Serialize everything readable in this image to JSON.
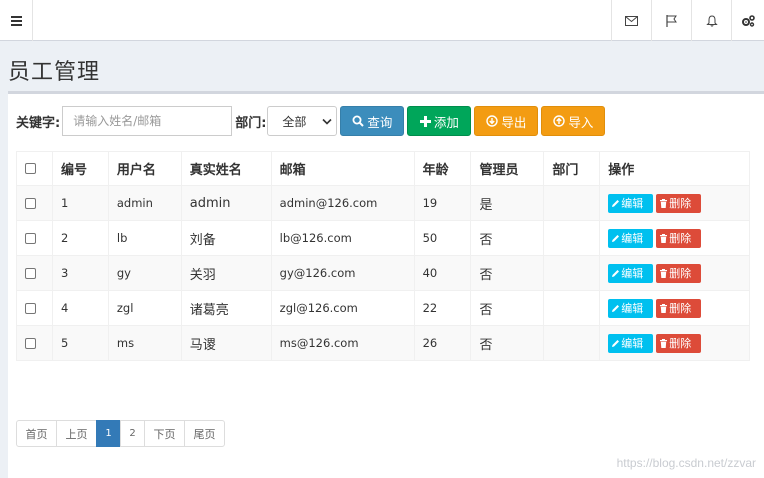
{
  "navbar": {
    "toggle_icon": "menu-icon",
    "right_icons": [
      "envelope-icon",
      "flag-icon",
      "bell-icon",
      "gears-icon"
    ]
  },
  "page": {
    "title": "员工管理"
  },
  "search": {
    "keyword_label": "关键字:",
    "keyword_placeholder": "请输入姓名/邮箱",
    "dept_label": "部门:",
    "dept_selected": "全部",
    "query_label": "查询",
    "add_label": "添加",
    "export_label": "导出",
    "import_label": "导入"
  },
  "table": {
    "headers": [
      "编号",
      "用户名",
      "真实姓名",
      "邮箱",
      "年龄",
      "管理员",
      "部门",
      "操作"
    ],
    "edit_label": "编辑",
    "delete_label": "删除",
    "rows": [
      {
        "id": "1",
        "username": "admin",
        "realname": "admin",
        "email": "admin@126.com",
        "age": "19",
        "admin": "是",
        "dept": ""
      },
      {
        "id": "2",
        "username": "lb",
        "realname": "刘备",
        "email": "lb@126.com",
        "age": "50",
        "admin": "否",
        "dept": ""
      },
      {
        "id": "3",
        "username": "gy",
        "realname": "关羽",
        "email": "gy@126.com",
        "age": "40",
        "admin": "否",
        "dept": ""
      },
      {
        "id": "4",
        "username": "zgl",
        "realname": "诸葛亮",
        "email": "zgl@126.com",
        "age": "22",
        "admin": "否",
        "dept": ""
      },
      {
        "id": "5",
        "username": "ms",
        "realname": "马谡",
        "email": "ms@126.com",
        "age": "26",
        "admin": "否",
        "dept": ""
      }
    ]
  },
  "pagination": {
    "first": "首页",
    "prev": "上页",
    "pages": [
      "1",
      "2"
    ],
    "current": "1",
    "next": "下页",
    "last": "尾页"
  },
  "watermark": "https://blog.csdn.net/zzvar",
  "colors": {
    "primary": "#3c8dbc",
    "success": "#00a65a",
    "warning": "#f39c12",
    "info": "#00c0ef",
    "danger": "#dd4b39",
    "page_active": "#337ab7"
  }
}
